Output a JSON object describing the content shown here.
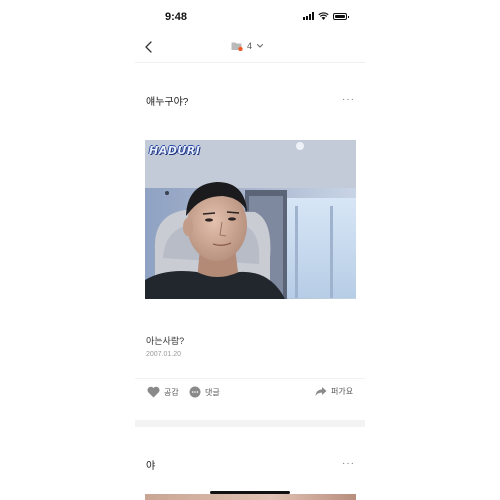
{
  "status_bar": {
    "time": "9:48",
    "icons": [
      "signal-icon",
      "wifi-icon",
      "battery-icon"
    ]
  },
  "nav": {
    "back_icon": "chevron-left-icon",
    "folder_icon": "folder-icon",
    "folder_count": "4",
    "dropdown_icon": "chevron-down-icon"
  },
  "posts": [
    {
      "title": "얘누구야?",
      "more_label": "···",
      "photo_logo": "HADURI",
      "caption": "아는사람?",
      "date": "2007.01.20",
      "actions": {
        "like_label": "공감",
        "comment_label": "댓글",
        "share_label": "퍼가요"
      }
    },
    {
      "title": "야",
      "more_label": "···"
    }
  ],
  "colors": {
    "badge": "#f05a28",
    "text_primary": "#222222",
    "text_secondary": "#999999",
    "logo_text": "#e8f0ff"
  }
}
